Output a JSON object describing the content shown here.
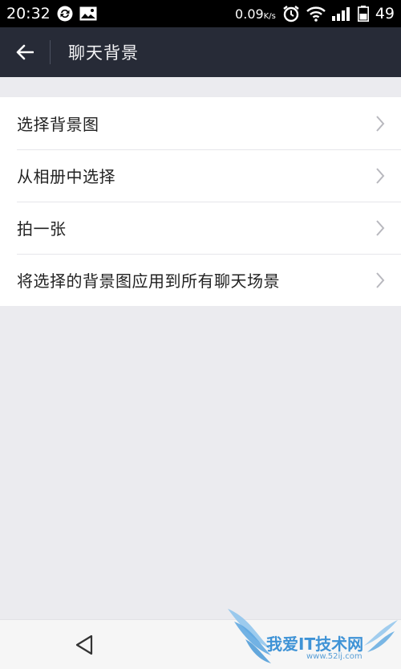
{
  "status_bar": {
    "time": "20:32",
    "net_speed": "0.09",
    "net_unit": "K/s",
    "battery": "49"
  },
  "header": {
    "title": "聊天背景"
  },
  "list": {
    "items": [
      {
        "label": "选择背景图"
      },
      {
        "label": "从相册中选择"
      },
      {
        "label": "拍一张"
      },
      {
        "label": "将选择的背景图应用到所有聊天场景"
      }
    ]
  },
  "watermark": {
    "text": "我爱IT技术网",
    "url": "www.52ij.com"
  },
  "colors": {
    "status_bar": "#000000",
    "title_bar": "#272b37",
    "background": "#ebebef",
    "list_background": "#ffffff",
    "watermark": "#3f93d6"
  },
  "icons": {
    "back": "arrow-left-icon",
    "chevron": "chevron-right-icon",
    "nav_back": "triangle-back-icon"
  }
}
